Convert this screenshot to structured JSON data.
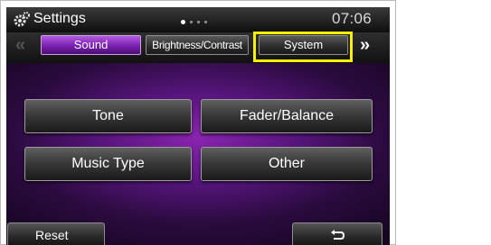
{
  "header": {
    "title": "Settings",
    "time": "07:06",
    "pages": {
      "count": 4,
      "current": 1
    }
  },
  "tabs": [
    {
      "label": "Sound",
      "active": true
    },
    {
      "label": "Brightness/Contrast",
      "active": false
    },
    {
      "label": "System",
      "active": false,
      "highlighted": true
    }
  ],
  "nav": {
    "prev_icon": "double-chevron-left-icon",
    "next_icon": "double-chevron-right-icon"
  },
  "options": [
    {
      "label": "Tone"
    },
    {
      "label": "Fader/Balance"
    },
    {
      "label": "Music Type"
    },
    {
      "label": "Other"
    }
  ],
  "footer": {
    "reset_label": "Reset",
    "back_icon": "return-arrow-icon"
  },
  "colors": {
    "accent": "#8a24b0",
    "highlight": "#f5f000",
    "active_tab": "#7a1fb0"
  }
}
